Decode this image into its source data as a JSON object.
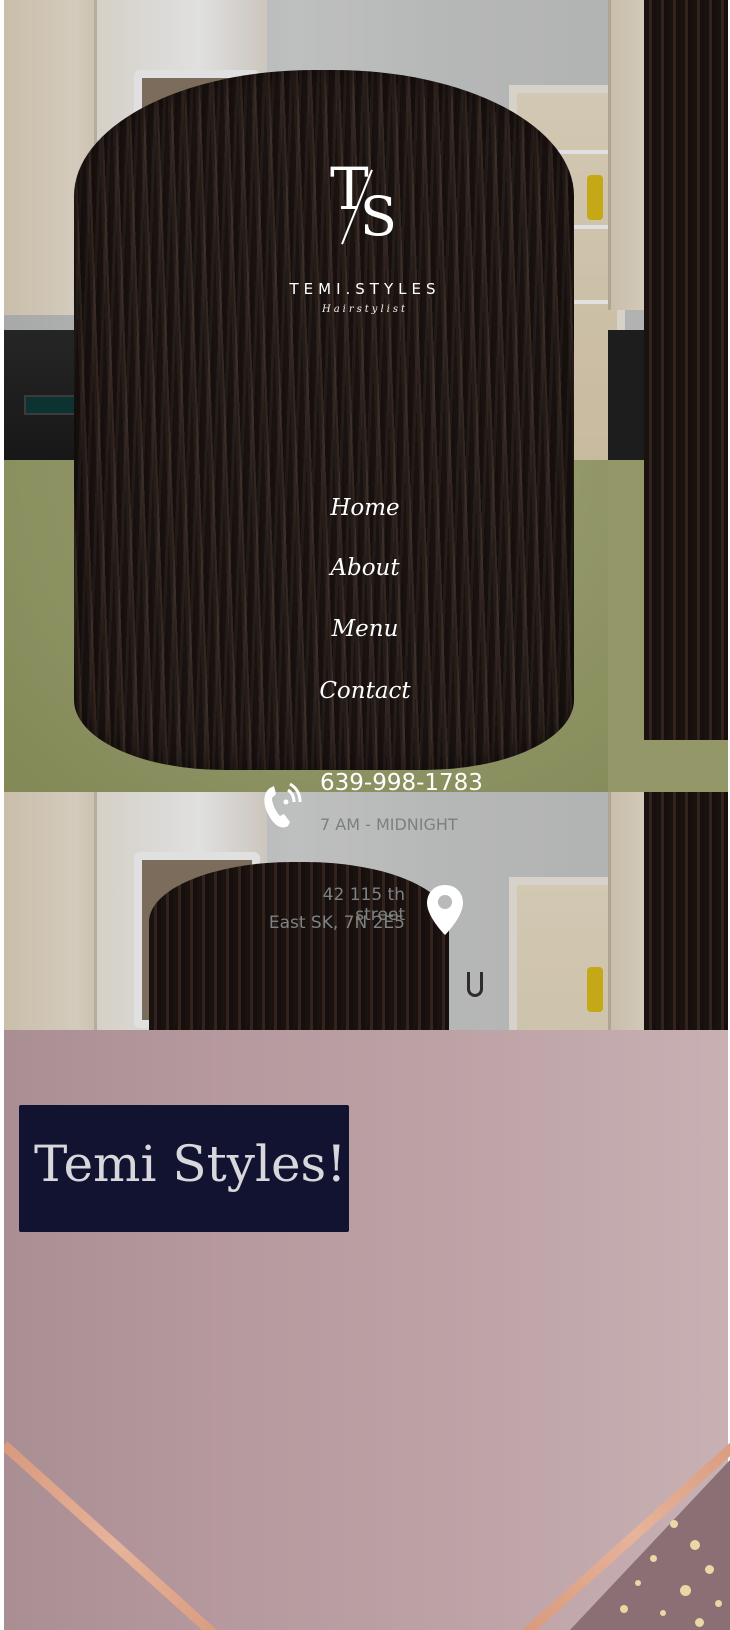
{
  "brand": {
    "logo_letters": "T/S",
    "name": "TEMI.STYLES",
    "tagline": "Hairstylist"
  },
  "nav": {
    "items": [
      {
        "label": "Home"
      },
      {
        "label": "About"
      },
      {
        "label": "Menu"
      },
      {
        "label": "Contact"
      }
    ]
  },
  "contact": {
    "phone": "639-998-1783",
    "hours": "7 AM - MIDNIGHT",
    "address_line1": "42 115 th street",
    "address_line2": "East SK, 7N 2E5",
    "phone_icon": "phone-icon",
    "location_icon": "map-pin-icon"
  },
  "section": {
    "title": "Temi Styles!"
  },
  "colors": {
    "title_card_bg": "#121331",
    "pink_section": "#b6999e",
    "accent_stripe": "#e7b39a"
  }
}
